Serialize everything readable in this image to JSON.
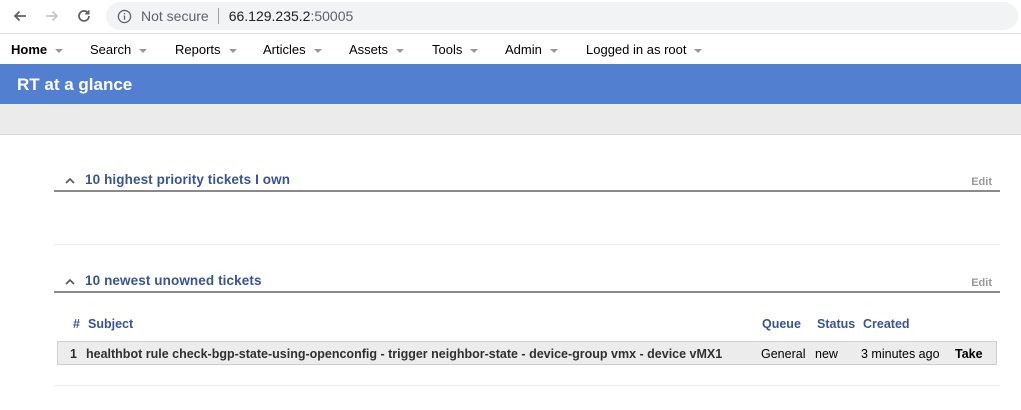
{
  "browser": {
    "security_label": "Not secure",
    "url_host": "66.129.235.2",
    "url_port": ":50005"
  },
  "menu": {
    "items": [
      {
        "label": "Home",
        "active": true
      },
      {
        "label": "Search"
      },
      {
        "label": "Reports"
      },
      {
        "label": "Articles"
      },
      {
        "label": "Assets"
      },
      {
        "label": "Tools"
      },
      {
        "label": "Admin"
      },
      {
        "label": "Logged in as root"
      }
    ]
  },
  "page": {
    "title": "RT at a glance"
  },
  "portlets": [
    {
      "title": "10 highest priority tickets I own",
      "edit_label": "Edit"
    },
    {
      "title": "10 newest unowned tickets",
      "edit_label": "Edit",
      "columns": [
        "#",
        "Subject",
        "Queue",
        "Status",
        "Created"
      ],
      "rows": [
        {
          "id": "1",
          "subject": "healthbot rule check-bgp-state-using-openconfig - trigger neighbor-state - device-group vmx - device vMX1",
          "queue": "General",
          "status": "new",
          "created": "3 minutes ago",
          "action": "Take"
        }
      ]
    }
  ],
  "colors": {
    "title_bar": "#527fcf",
    "portlet_title": "#3a5394"
  }
}
